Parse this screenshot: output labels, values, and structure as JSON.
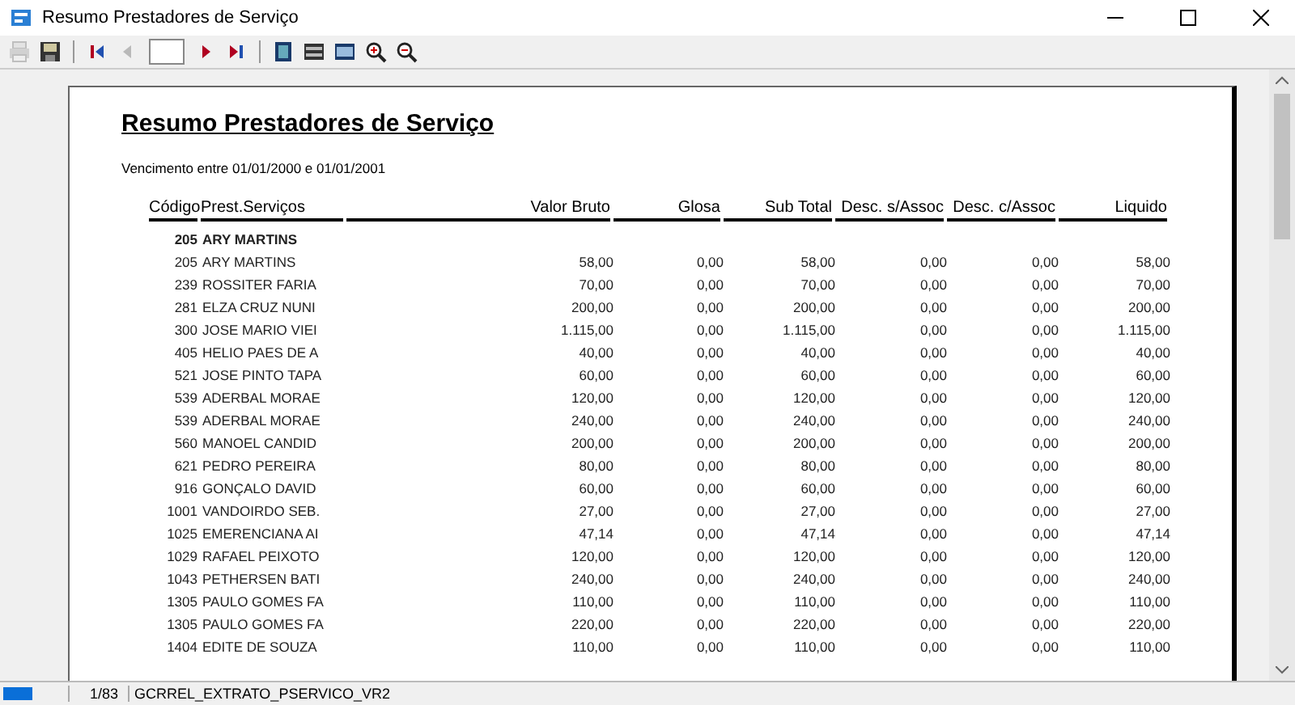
{
  "window": {
    "title": "Resumo Prestadores de Serviço"
  },
  "toolbar": [
    {
      "kind": "print",
      "disabled": true
    },
    {
      "kind": "save",
      "disabled": false
    },
    {
      "kind": "first",
      "disabled": false
    },
    {
      "kind": "prev",
      "disabled": true
    },
    {
      "kind": "page"
    },
    {
      "kind": "next",
      "disabled": false
    },
    {
      "kind": "last",
      "disabled": false
    },
    {
      "kind": "whole",
      "disabled": false
    },
    {
      "kind": "width",
      "disabled": false
    },
    {
      "kind": "full",
      "disabled": false
    },
    {
      "kind": "zoomin",
      "disabled": false
    },
    {
      "kind": "zoomout",
      "disabled": false
    }
  ],
  "report": {
    "title": "Resumo Prestadores de Serviço",
    "subtitle": "Vencimento entre 01/01/2000 e 01/01/2001",
    "columns": [
      "Código",
      "Prest.Serviços",
      "Valor Bruto",
      "Glosa",
      "Sub Total",
      "Desc. s/Assoc",
      "Desc. c/Assoc",
      "Liquido"
    ],
    "group": {
      "code": "205",
      "name": "ARY MARTINS"
    },
    "rows": [
      [
        "205",
        "ARY MARTINS",
        "58,00",
        "0,00",
        "58,00",
        "0,00",
        "0,00",
        "58,00"
      ],
      [
        "239",
        "ROSSITER FARIA",
        "70,00",
        "0,00",
        "70,00",
        "0,00",
        "0,00",
        "70,00"
      ],
      [
        "281",
        "ELZA CRUZ NUNI",
        "200,00",
        "0,00",
        "200,00",
        "0,00",
        "0,00",
        "200,00"
      ],
      [
        "300",
        "JOSE MARIO VIEI",
        "1.115,00",
        "0,00",
        "1.115,00",
        "0,00",
        "0,00",
        "1.115,00"
      ],
      [
        "405",
        "HELIO PAES DE A",
        "40,00",
        "0,00",
        "40,00",
        "0,00",
        "0,00",
        "40,00"
      ],
      [
        "521",
        "JOSE PINTO TAPA",
        "60,00",
        "0,00",
        "60,00",
        "0,00",
        "0,00",
        "60,00"
      ],
      [
        "539",
        "ADERBAL MORAE",
        "120,00",
        "0,00",
        "120,00",
        "0,00",
        "0,00",
        "120,00"
      ],
      [
        "539",
        "ADERBAL MORAE",
        "240,00",
        "0,00",
        "240,00",
        "0,00",
        "0,00",
        "240,00"
      ],
      [
        "560",
        "MANOEL CANDID",
        "200,00",
        "0,00",
        "200,00",
        "0,00",
        "0,00",
        "200,00"
      ],
      [
        "621",
        "PEDRO PEREIRA",
        "80,00",
        "0,00",
        "80,00",
        "0,00",
        "0,00",
        "80,00"
      ],
      [
        "916",
        "GONÇALO DAVID",
        "60,00",
        "0,00",
        "60,00",
        "0,00",
        "0,00",
        "60,00"
      ],
      [
        "1001",
        "VANDOIRDO SEB.",
        "27,00",
        "0,00",
        "27,00",
        "0,00",
        "0,00",
        "27,00"
      ],
      [
        "1025",
        "EMERENCIANA AI",
        "47,14",
        "0,00",
        "47,14",
        "0,00",
        "0,00",
        "47,14"
      ],
      [
        "1029",
        "RAFAEL PEIXOTO",
        "120,00",
        "0,00",
        "120,00",
        "0,00",
        "0,00",
        "120,00"
      ],
      [
        "1043",
        "PETHERSEN BATI",
        "240,00",
        "0,00",
        "240,00",
        "0,00",
        "0,00",
        "240,00"
      ],
      [
        "1305",
        "PAULO GOMES FA",
        "110,00",
        "0,00",
        "110,00",
        "0,00",
        "0,00",
        "110,00"
      ],
      [
        "1305",
        "PAULO GOMES FA",
        "220,00",
        "0,00",
        "220,00",
        "0,00",
        "0,00",
        "220,00"
      ],
      [
        "1404",
        "EDITE DE SOUZA",
        "110,00",
        "0,00",
        "110,00",
        "0,00",
        "0,00",
        "110,00"
      ]
    ]
  },
  "status_bar": {
    "page": "1/83",
    "report_name": "GCRREL_EXTRATO_PSERVICO_VR2"
  }
}
